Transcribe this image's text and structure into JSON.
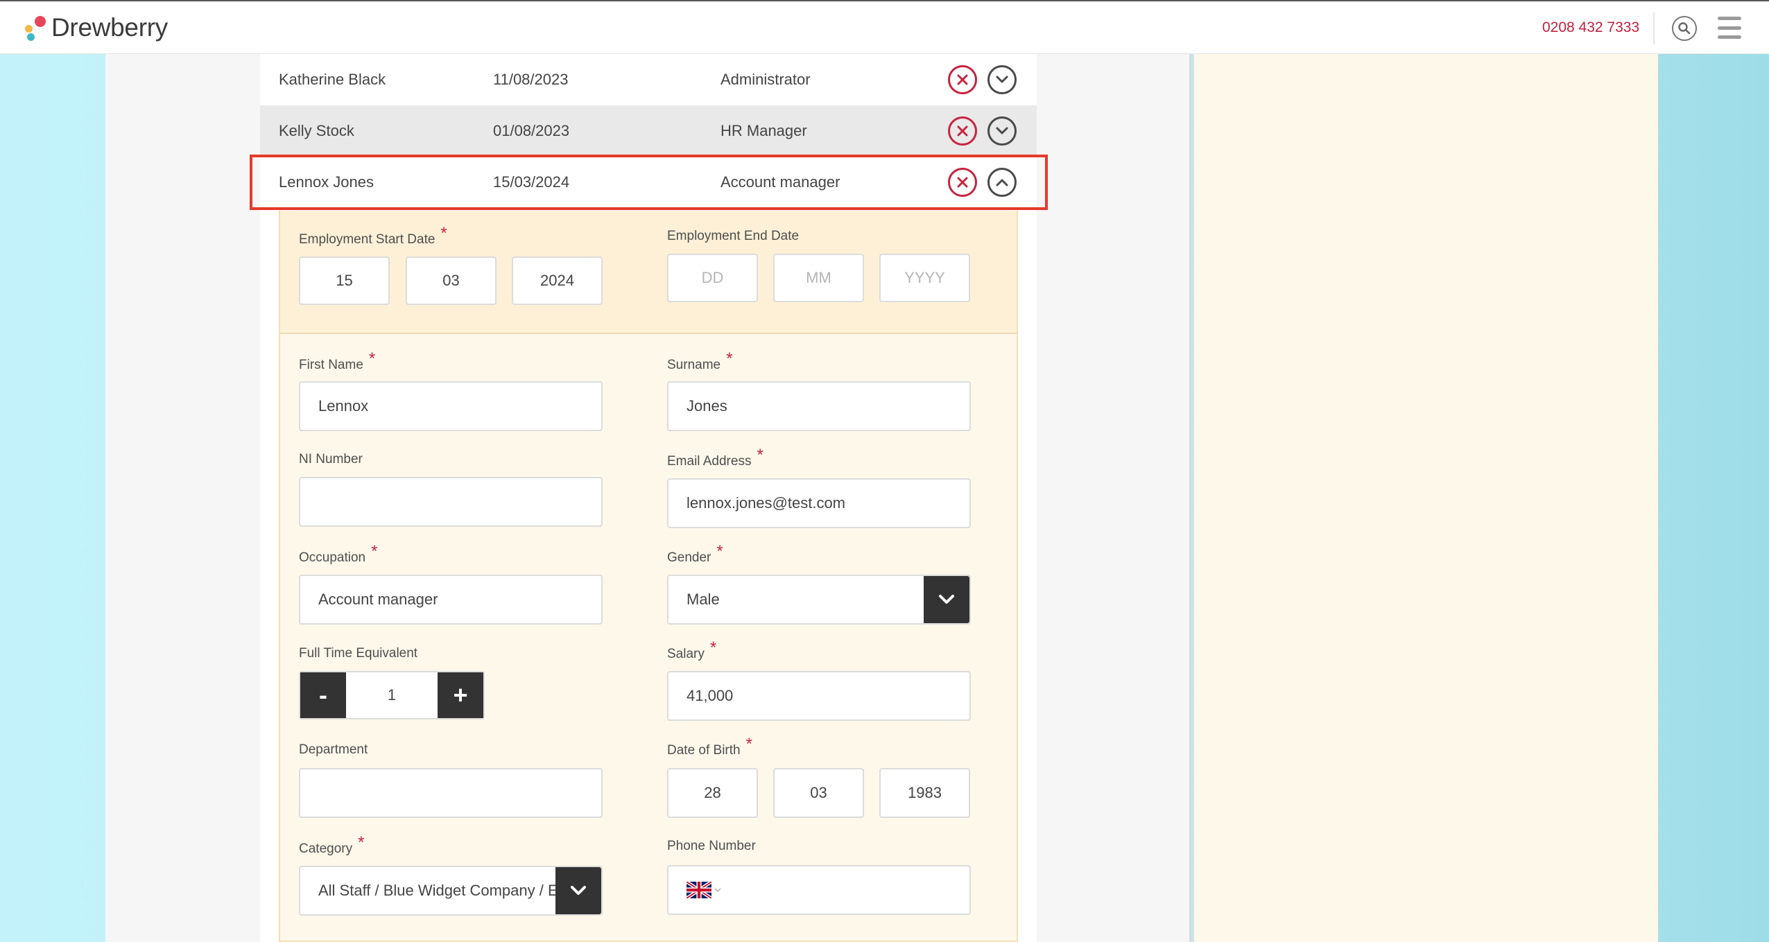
{
  "header": {
    "brand": "Drewberry",
    "phone": "0208 432 7333",
    "search_icon": "search-icon",
    "menu_icon": "hamburger-menu-icon"
  },
  "colors": {
    "accent_red": "#c8243f",
    "highlight": "#e53a2a",
    "dark_control": "#333333",
    "form_bg": "#fef8eb"
  },
  "employees": [
    {
      "name": "Katherine Black",
      "date": "11/08/2023",
      "role": "Administrator",
      "expanded": false
    },
    {
      "name": "Kelly Stock",
      "date": "01/08/2023",
      "role": "HR Manager",
      "expanded": false
    },
    {
      "name": "Lennox Jones",
      "date": "15/03/2024",
      "role": "Account manager",
      "expanded": true
    }
  ],
  "form": {
    "start_date": {
      "label": "Employment Start Date",
      "required": "*",
      "day": "15",
      "month": "03",
      "year": "2024"
    },
    "end_date": {
      "label": "Employment End Date",
      "day_ph": "DD",
      "month_ph": "MM",
      "year_ph": "YYYY"
    },
    "first_name": {
      "label": "First Name",
      "required": "*",
      "value": "Lennox"
    },
    "surname": {
      "label": "Surname",
      "required": "*",
      "value": "Jones"
    },
    "ni_number": {
      "label": "NI Number",
      "value": ""
    },
    "email": {
      "label": "Email Address",
      "required": "*",
      "value": "lennox.jones@test.com"
    },
    "occupation": {
      "label": "Occupation",
      "required": "*",
      "value": "Account manager"
    },
    "gender": {
      "label": "Gender",
      "required": "*",
      "value": "Male"
    },
    "fte": {
      "label": "Full Time Equivalent",
      "value": "1",
      "minus": "-",
      "plus": "+"
    },
    "salary": {
      "label": "Salary",
      "required": "*",
      "value": "41,000"
    },
    "department": {
      "label": "Department",
      "value": ""
    },
    "dob": {
      "label": "Date of Birth",
      "required": "*",
      "day": "28",
      "month": "03",
      "year": "1983"
    },
    "category": {
      "label": "Category",
      "required": "*",
      "value": "All Staff / Blue Widget Company / EC"
    },
    "phone": {
      "label": "Phone Number",
      "value": "",
      "flag": "uk-flag-icon"
    }
  }
}
